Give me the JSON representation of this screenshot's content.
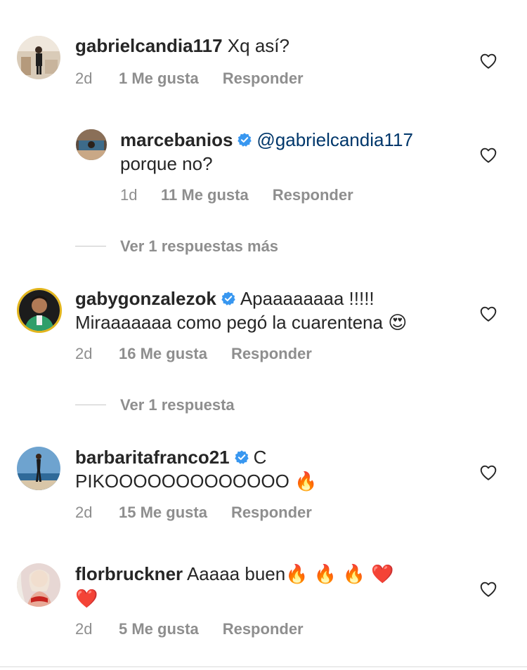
{
  "comments": [
    {
      "username": "gabrielcandia117",
      "verified": false,
      "text": "Xq así?",
      "time": "2d",
      "likes": "1 Me gusta",
      "reply": "Responder"
    },
    {
      "username": "marcebanios",
      "verified": true,
      "mention": "@gabrielcandia117",
      "text": "porque no?",
      "time": "1d",
      "likes": "11 Me gusta",
      "reply": "Responder"
    },
    {
      "username": "gabygonzalezok",
      "verified": true,
      "text_line1": "Apaaaaaaaa !!!!!",
      "text_line2": "Miraaaaaaa como pegó la cuarentena",
      "emoji": "😍",
      "time": "2d",
      "likes": "16 Me gusta",
      "reply": "Responder"
    },
    {
      "username": "barbaritafranco21",
      "verified": true,
      "text_line1": "C",
      "text_line2": "PIKOOOOOOOOOOOOO",
      "emoji": "🔥",
      "time": "2d",
      "likes": "15 Me gusta",
      "reply": "Responder"
    },
    {
      "username": "florbruckner",
      "verified": false,
      "text": "Aaaaa buen",
      "emojis_line1": "🔥 🔥 🔥  ❤️",
      "emojis_line2": "❤️",
      "time": "2d",
      "likes": "5 Me gusta",
      "reply": "Responder"
    }
  ],
  "view_replies": [
    "Ver 1 respuestas más",
    "Ver 1 respuesta"
  ],
  "colors": {
    "text": "#262626",
    "muted": "#8e8e8e",
    "mention": "#00376b",
    "verified": "#3897f0"
  }
}
